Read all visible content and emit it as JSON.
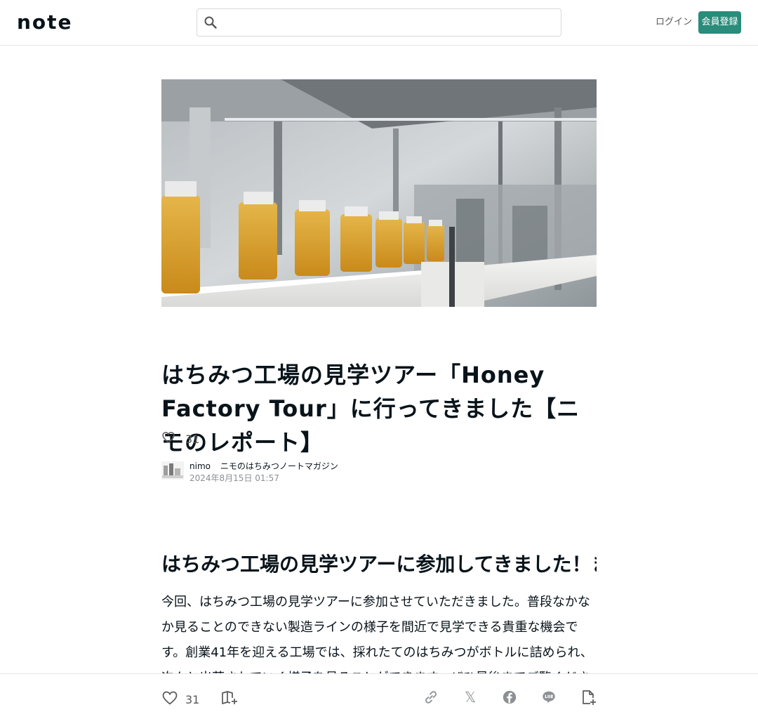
{
  "header": {
    "logo": "note",
    "search_placeholder": "",
    "login_label": "ログイン",
    "signup_label": "会員登録"
  },
  "article": {
    "title": "はちみつ工場の見学ツアー「Honey Factory Tour」に行ってきました【ニモのレポート】",
    "like_count": "31",
    "author_name": "nimo",
    "author_magazine": "ニモのはちみつノートマガジン",
    "published_at": "2024年8月15日 01:57",
    "heading": "はちみつ工場の見学ツアーに参加してきました！まずは工場の外観から…",
    "body": "今回、はちみつ工場の見学ツアーに参加させていただきました。普段なかなか見ることのできない製造ラインの様子を間近で見学できる貴重な機会です。創業41年を迎える工場では、採れたてのはちみつがボトルに詰められ、次々と出荷されていく様子を見ることができます。ぜひ最後までご覧ください。"
  },
  "bottom_bar": {
    "like_count": "31",
    "x_label": "𝕏"
  },
  "icons": {
    "search": "search-icon",
    "heart": "heart-icon",
    "magazine": "magazine-add-icon",
    "link": "link-icon",
    "x": "x-icon",
    "facebook": "facebook-icon",
    "line": "line-icon",
    "bookmark": "note-add-icon"
  },
  "colors": {
    "accent": "#2a8c7a",
    "text": "#08131a",
    "muted": "#8c9094"
  }
}
